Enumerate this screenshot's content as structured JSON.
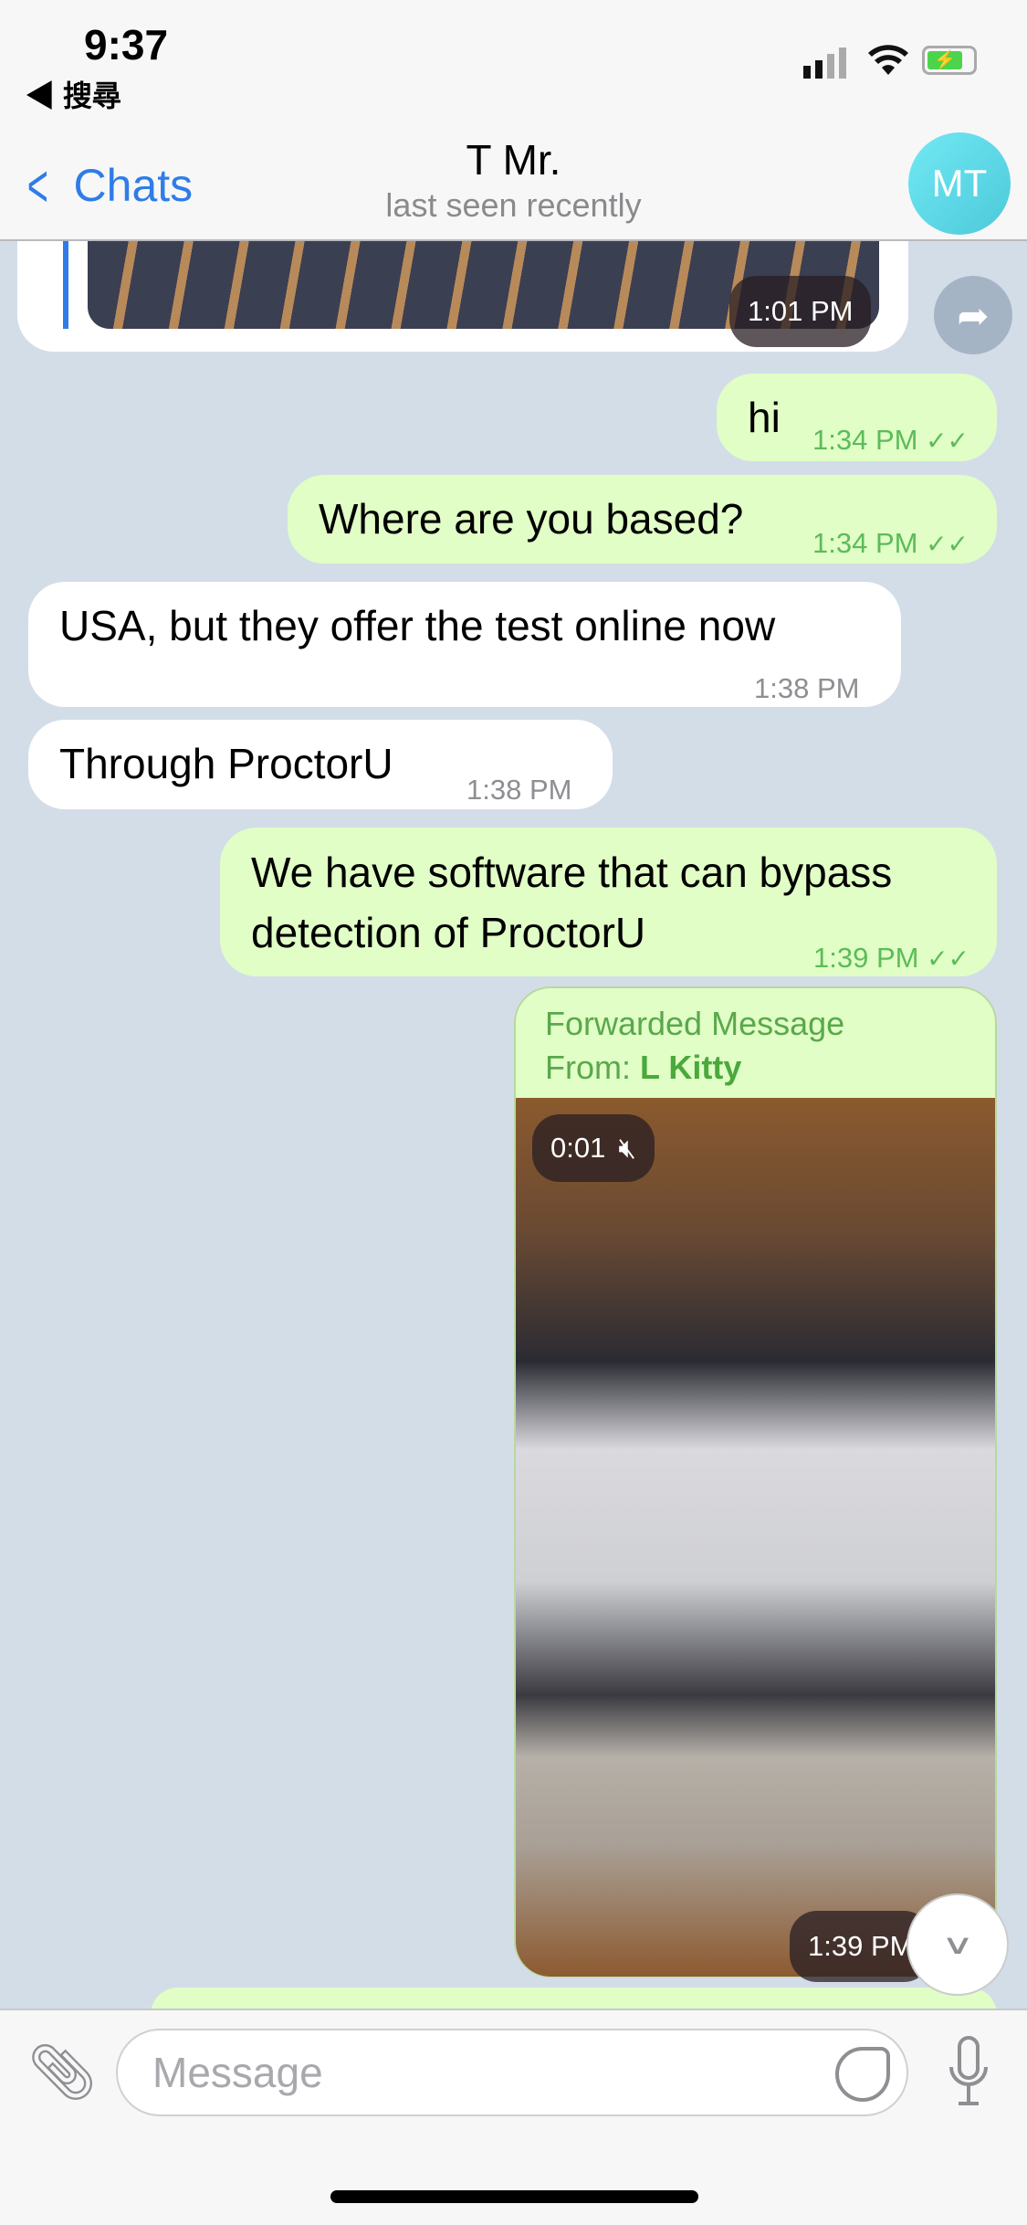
{
  "status_bar": {
    "time": "9:37",
    "back_app": "◀ 搜尋",
    "battery": "charging"
  },
  "header": {
    "back_label": "Chats",
    "title": "T Mr.",
    "subtitle": "last seen recently",
    "avatar_initials": "MT",
    "avatar_color": "#5fd9e6"
  },
  "messages": [
    {
      "type": "image",
      "direction": "in",
      "time": "1:01 PM"
    },
    {
      "direction": "out",
      "text": "hi",
      "time": "1:34 PM",
      "status": "read"
    },
    {
      "direction": "out",
      "text": "Where are you based?",
      "time": "1:34 PM",
      "status": "read"
    },
    {
      "direction": "in",
      "text": "USA, but they offer the test online now",
      "time": "1:38 PM"
    },
    {
      "direction": "in",
      "text": "Through ProctorU",
      "time": "1:38 PM"
    },
    {
      "direction": "out",
      "text": "We have software that can bypass detection of ProctorU",
      "time": "1:39 PM",
      "status": "read"
    },
    {
      "type": "video",
      "direction": "out",
      "forward_header": "Forwarded Message",
      "from_label": "From:",
      "from_name": "L Kitty",
      "duration": "0:01",
      "muted": true,
      "time": "1:39 PM"
    }
  ],
  "input": {
    "placeholder": "Message"
  },
  "colors": {
    "accent": "#2f7ce8",
    "outgoing_bubble": "#e1fec6",
    "read_check": "#5dbb5a",
    "forward_green": "#4aa83c"
  }
}
